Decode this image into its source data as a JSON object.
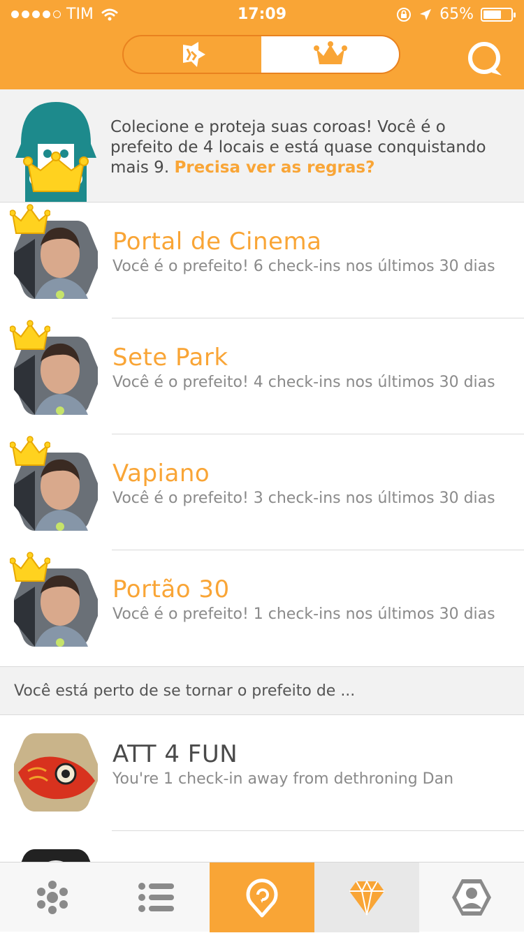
{
  "status_bar": {
    "carrier": "TIM",
    "time": "17:09",
    "battery": "65%",
    "battery_level": 0.65
  },
  "header": {
    "segments": [
      {
        "icon": "stickers-icon",
        "active": false
      },
      {
        "icon": "crown-icon",
        "active": true
      }
    ],
    "search_icon": "search-icon"
  },
  "intro": {
    "text": "Colecione e proteja suas coroas! Você é o prefeito de 4 locais e está quase conquistando mais 9. ",
    "link": "Precisa ver as regras?"
  },
  "mayorships": [
    {
      "name": "Portal de Cinema",
      "desc": "Você é o prefeito! 6 check-ins nos últimos 30 dias"
    },
    {
      "name": "Sete Park",
      "desc": "Você é o prefeito! 4 check-ins nos últimos 30 dias"
    },
    {
      "name": "Vapiano",
      "desc": "Você é o prefeito! 3 check-ins nos últimos 30 dias"
    },
    {
      "name": "Portão 30",
      "desc": "Você é o prefeito! 1 check-ins nos últimos 30 dias"
    }
  ],
  "section_header": "Você está perto de se tornar o prefeito de ...",
  "nearby": [
    {
      "name": "ATT 4 FUN",
      "desc": "You're 1 check-in away from dethroning Dan"
    }
  ],
  "tabbar": [
    {
      "icon": "history-icon"
    },
    {
      "icon": "list-icon"
    },
    {
      "icon": "checkin-icon"
    },
    {
      "icon": "diamond-icon"
    },
    {
      "icon": "profile-icon"
    }
  ],
  "colors": {
    "accent": "#F9A536",
    "accent_dark": "#E9821F",
    "mascot": "#1D8A8C"
  }
}
